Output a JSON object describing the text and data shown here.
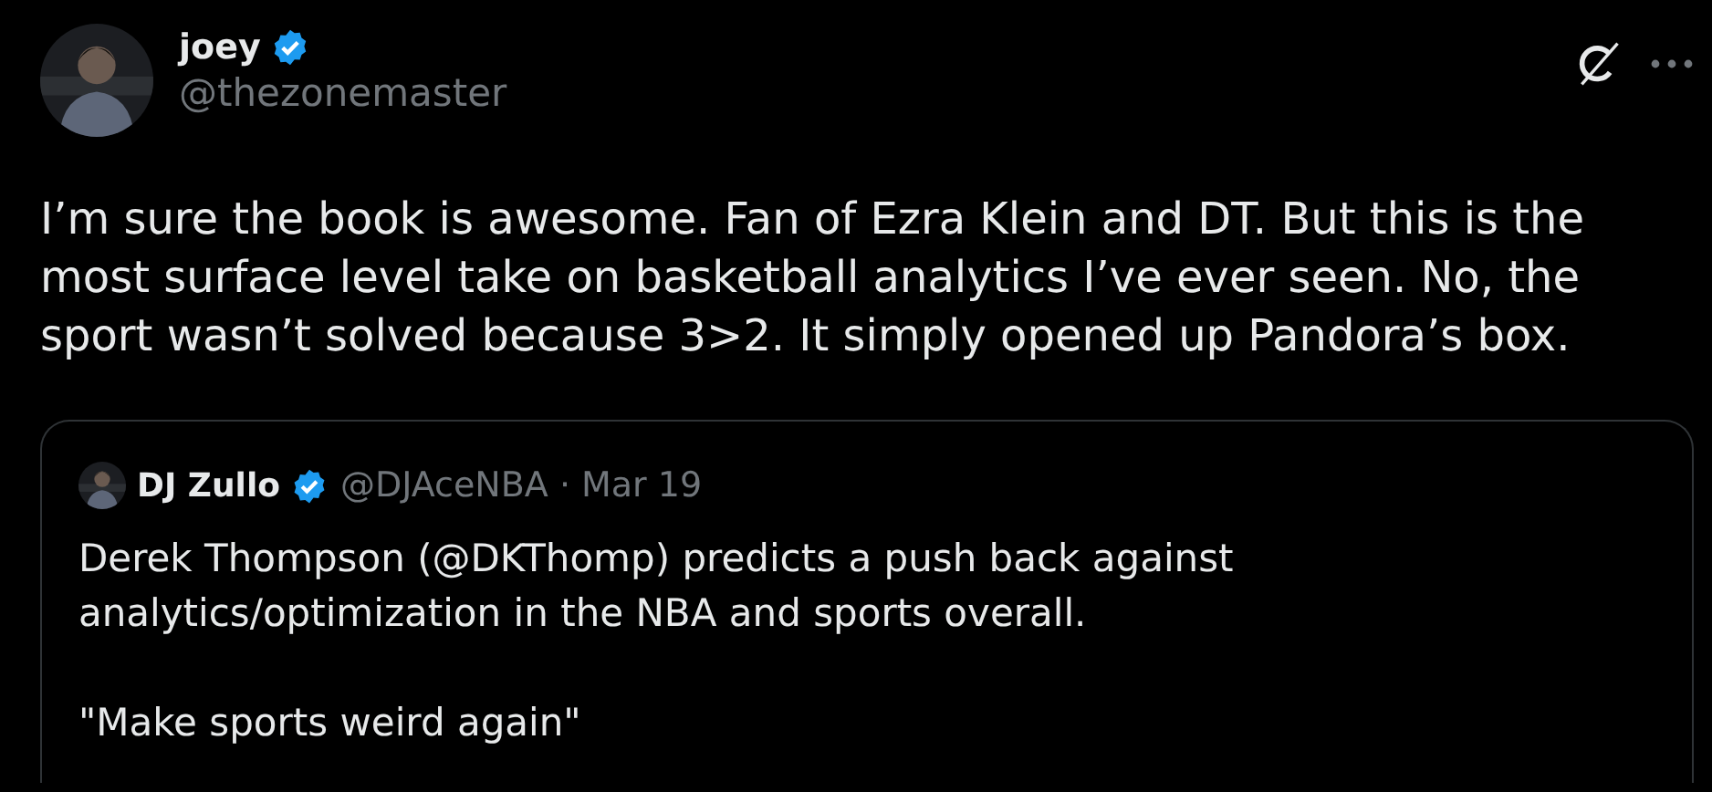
{
  "tweet": {
    "author": {
      "name": "joey",
      "verified": true,
      "handle": "@thezonemaster"
    },
    "text": "I’m sure the book is awesome. Fan of Ezra Klein and DT. But this is the\nmost surface level take on basketball analytics I’ve ever seen. No, the\nsport wasn’t solved because 3>2. It simply opened up Pandora’s box.",
    "quote": {
      "author": {
        "name": "DJ Zullo",
        "verified": true,
        "handle": "@DJAceNBA",
        "date": "· Mar 19"
      },
      "paragraphs": [
        "Derek Thompson (@DKThomp) predicts a push back against\nanalytics/optimization in the NBA and sports overall.",
        "\"Make sports weird again\""
      ]
    }
  }
}
